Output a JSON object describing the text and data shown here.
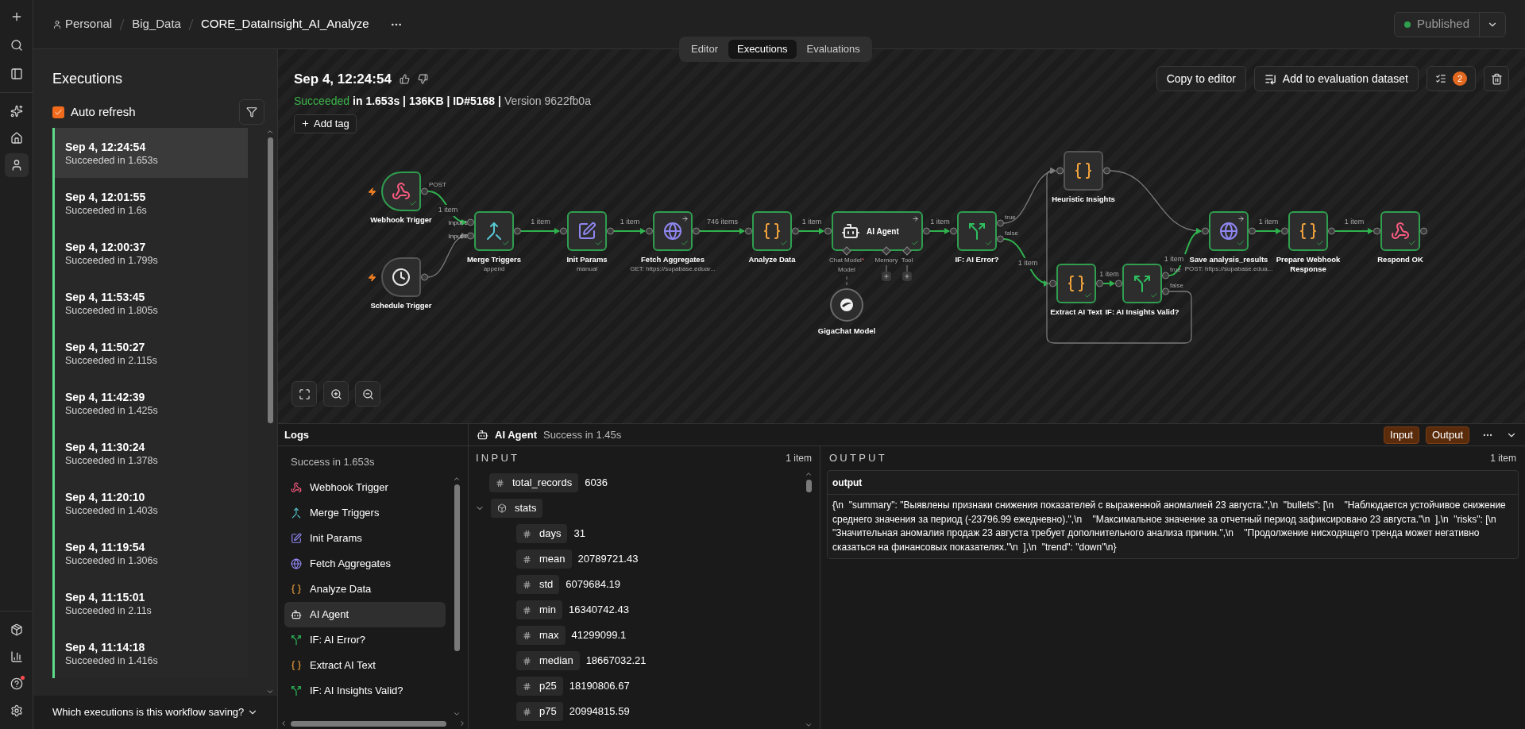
{
  "rail": {
    "top": [
      {
        "kind": "add",
        "selected": false
      },
      {
        "kind": "search",
        "selected": false
      },
      {
        "kind": "panel",
        "selected": false
      }
    ],
    "main": [
      {
        "kind": "sparkle",
        "selected": false
      },
      {
        "kind": "home",
        "selected": false
      },
      {
        "kind": "user",
        "selected": true
      }
    ],
    "bottom": [
      {
        "kind": "package",
        "selected": false
      },
      {
        "kind": "chart",
        "selected": false
      },
      {
        "kind": "help",
        "selected": false,
        "alert": true
      },
      {
        "kind": "settings",
        "selected": false
      }
    ]
  },
  "header": {
    "breadcrumb": [
      "Personal",
      "Big_Data",
      "CORE_DataInsight_AI_Analyze"
    ],
    "publish": {
      "label": "Published"
    }
  },
  "view_tabs": [
    {
      "label": "Editor",
      "selected": false
    },
    {
      "label": "Executions",
      "selected": true
    },
    {
      "label": "Evaluations",
      "selected": false
    }
  ],
  "executions_panel": {
    "title": "Executions",
    "auto_refresh": {
      "label": "Auto refresh",
      "checked": true
    },
    "items": [
      {
        "time": "Sep 4, 12:24:54",
        "status": "Succeeded in 1.653s",
        "selected": true
      },
      {
        "time": "Sep 4, 12:01:55",
        "status": "Succeeded in 1.6s",
        "selected": false
      },
      {
        "time": "Sep 4, 12:00:37",
        "status": "Succeeded in 1.799s",
        "selected": false
      },
      {
        "time": "Sep 4, 11:53:45",
        "status": "Succeeded in 1.805s",
        "selected": false
      },
      {
        "time": "Sep 4, 11:50:27",
        "status": "Succeeded in 2.115s",
        "selected": false
      },
      {
        "time": "Sep 4, 11:42:39",
        "status": "Succeeded in 1.425s",
        "selected": false
      },
      {
        "time": "Sep 4, 11:30:24",
        "status": "Succeeded in 1.378s",
        "selected": false
      },
      {
        "time": "Sep 4, 11:20:10",
        "status": "Succeeded in 1.403s",
        "selected": false
      },
      {
        "time": "Sep 4, 11:19:54",
        "status": "Succeeded in 1.306s",
        "selected": false
      },
      {
        "time": "Sep 4, 11:15:01",
        "status": "Succeeded in 2.11s",
        "selected": false
      },
      {
        "time": "Sep 4, 11:14:18",
        "status": "Succeeded in 1.416s",
        "selected": false
      }
    ],
    "footer": "Which executions is this workflow saving?"
  },
  "execution": {
    "title": "Sep 4, 12:24:54",
    "summary": [
      {
        "kind": "status",
        "text": "Succeeded"
      },
      {
        "kind": "meta",
        "text": "in 1.653s | 136KB | ID#5168 |"
      },
      {
        "kind": "version",
        "text": "Version 9622fb0a"
      }
    ],
    "add_tag": "Add tag",
    "actions": [
      "Copy to editor",
      "Add to evaluation dataset"
    ],
    "badge": "2"
  },
  "canvas": {
    "nodes": [
      {
        "kind": "webhook",
        "label": "Webhook Trigger",
        "trigger": true,
        "executed": true,
        "outputs": [
          "POST"
        ]
      },
      {
        "kind": "schedule",
        "label": "Schedule Trigger",
        "trigger": true,
        "executed": false
      },
      {
        "kind": "merge",
        "label": "Merge Triggers",
        "subtitle": "append",
        "trigger": false,
        "executed": true,
        "inputs": [
          "Input 1",
          "Input 2"
        ]
      },
      {
        "kind": "set",
        "label": "Init Params",
        "subtitle": "manual",
        "trigger": false,
        "executed": true
      },
      {
        "kind": "http",
        "label": "Fetch Aggregates",
        "subtitle": "GET: https://supabase.eduar...",
        "trigger": false,
        "executed": true
      },
      {
        "kind": "code",
        "label": "Analyze Data",
        "trigger": false,
        "executed": true
      },
      {
        "kind": "agent",
        "label": "AI Agent",
        "trigger": false,
        "executed": true,
        "subports": [
          {
            "label": "Chat Model",
            "mark": "*",
            "add_button": false
          },
          {
            "label": "Memory",
            "add_button": true
          },
          {
            "label": "Tool",
            "add_button": true
          }
        ]
      },
      {
        "kind": "if",
        "label": "IF: AI Error?",
        "trigger": false,
        "executed": true,
        "outputs": [
          "true",
          "false"
        ]
      },
      {
        "kind": "code",
        "label": "Heuristic Insights",
        "trigger": false,
        "executed": false
      },
      {
        "kind": "code",
        "label": "Extract AI Text",
        "trigger": false,
        "executed": true
      },
      {
        "kind": "if",
        "label": "IF: AI Insights Valid?",
        "trigger": false,
        "executed": true,
        "outputs": [
          "true",
          "false"
        ]
      },
      {
        "kind": "http",
        "label": "Save analysis_results",
        "subtitle": "POST: https://supabase.edua...",
        "trigger": false,
        "executed": true
      },
      {
        "kind": "code",
        "label": "Prepare Webhook Response",
        "trigger": false,
        "executed": true
      },
      {
        "kind": "webhook",
        "label": "Respond OK",
        "trigger": false,
        "executed": true
      }
    ],
    "model": {
      "label": "GigaChat Model",
      "port": "Model"
    },
    "edges": [
      {
        "label": "1 item",
        "active": true
      },
      {
        "active": false
      },
      {
        "label": "1 item",
        "active": true
      },
      {
        "label": "1 item",
        "active": true
      },
      {
        "label": "746 items",
        "active": true
      },
      {
        "label": "1 item",
        "active": true
      },
      {
        "label": "1 item",
        "active": true
      },
      {
        "active": false
      },
      {
        "label": "1 item",
        "active": true
      },
      {
        "active": false
      },
      {
        "label": "1 item",
        "active": true
      },
      {
        "label": "1 item",
        "active": true
      },
      {
        "active": false
      },
      {
        "label": "1 item",
        "active": true
      },
      {
        "label": "1 item",
        "active": true
      }
    ]
  },
  "logs": {
    "title": "Logs",
    "summary": "Success in 1.653s",
    "items": [
      {
        "kind": "webhook",
        "label": "Webhook Trigger",
        "selected": false
      },
      {
        "kind": "merge",
        "label": "Merge Triggers",
        "selected": false
      },
      {
        "kind": "set",
        "label": "Init Params",
        "selected": false
      },
      {
        "kind": "http",
        "label": "Fetch Aggregates",
        "selected": false
      },
      {
        "kind": "code",
        "label": "Analyze Data",
        "selected": false
      },
      {
        "kind": "agent",
        "label": "AI Agent",
        "selected": true
      },
      {
        "kind": "if",
        "label": "IF: AI Error?",
        "selected": false
      },
      {
        "kind": "code",
        "label": "Extract AI Text",
        "selected": false
      },
      {
        "kind": "if",
        "label": "IF: AI Insights Valid?",
        "selected": false
      }
    ]
  },
  "detail": {
    "node": {
      "kind": "agent",
      "label": "AI Agent"
    },
    "status": "Success in 1.45s",
    "buttons": [
      "Input",
      "Output"
    ],
    "input": {
      "title": "INPUT",
      "count": "1 item",
      "fields": [
        {
          "kind": "number",
          "key": "total_records",
          "value": "6036"
        },
        {
          "kind": "object",
          "key": "stats",
          "expanded": true,
          "children": [
            {
              "kind": "number",
              "key": "days",
              "value": "31"
            },
            {
              "kind": "number",
              "key": "mean",
              "value": "20789721.43"
            },
            {
              "kind": "number",
              "key": "std",
              "value": "6079684.19"
            },
            {
              "kind": "number",
              "key": "min",
              "value": "16340742.43"
            },
            {
              "kind": "number",
              "key": "max",
              "value": "41299099.1"
            },
            {
              "kind": "number",
              "key": "median",
              "value": "18667032.21"
            },
            {
              "kind": "number",
              "key": "p25",
              "value": "18190806.67"
            },
            {
              "kind": "number",
              "key": "p75",
              "value": "20994815.59"
            }
          ]
        }
      ]
    },
    "output": {
      "title": "OUTPUT",
      "count": "1 item",
      "field": "output",
      "text": "{\\n  \"summary\": \"Выявлены признаки снижения показателей с выраженной аномалией 23 августа.\",\\n  \"bullets\": [\\n    \"Наблюдается устойчивое снижение среднего значения за период (-23796.99 ежедневно).\",\\n    \"Максимальное значение за отчетный период зафиксировано 23 августа.\"\\n  ],\\n  \"risks\": [\\n    \"Значительная аномалия продаж 23 августа требует дополнительного анализа причин.\",\\n    \"Продолжение нисходящего тренда может негативно сказаться на финансовых показателях.\"\\n  ],\\n  \"trend\": \"down\"\\n}"
    }
  }
}
